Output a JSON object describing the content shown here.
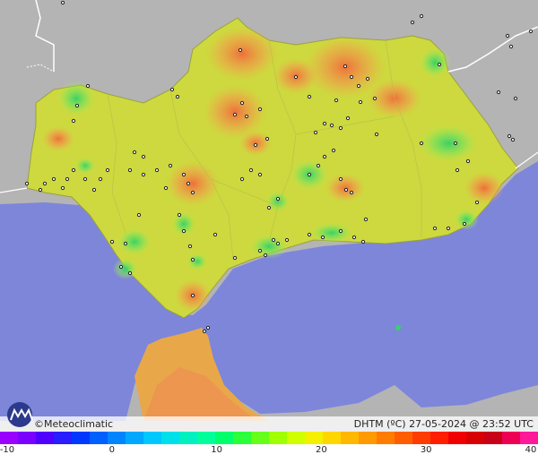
{
  "map": {
    "credit": "©Meteoclimatic",
    "caption": "DHTM (ºC)  27-05-2024 @ 23:52 UTC",
    "colors": {
      "land_outside": "#b4b4b4",
      "sea": "#7d86d9",
      "border_line": "#ffffff",
      "station_marker": "#222222"
    }
  },
  "legend": {
    "ticks": [
      "-10",
      "0",
      "10",
      "20",
      "30",
      "40"
    ],
    "colors": [
      "#9a00ff",
      "#7a00ff",
      "#4f00ff",
      "#2a1dff",
      "#0038ff",
      "#0060ff",
      "#0085ff",
      "#00a8ff",
      "#00c8ff",
      "#00e0e8",
      "#00f0c0",
      "#00ff9a",
      "#00ff6a",
      "#2aff3a",
      "#66ff1a",
      "#a0ff00",
      "#d0ff00",
      "#f4f000",
      "#ffd600",
      "#ffb800",
      "#ff9a00",
      "#ff7c00",
      "#ff5e00",
      "#ff3c00",
      "#ff1e00",
      "#f00000",
      "#d80000",
      "#c80018",
      "#ee0055",
      "#ff1a9a"
    ]
  }
}
